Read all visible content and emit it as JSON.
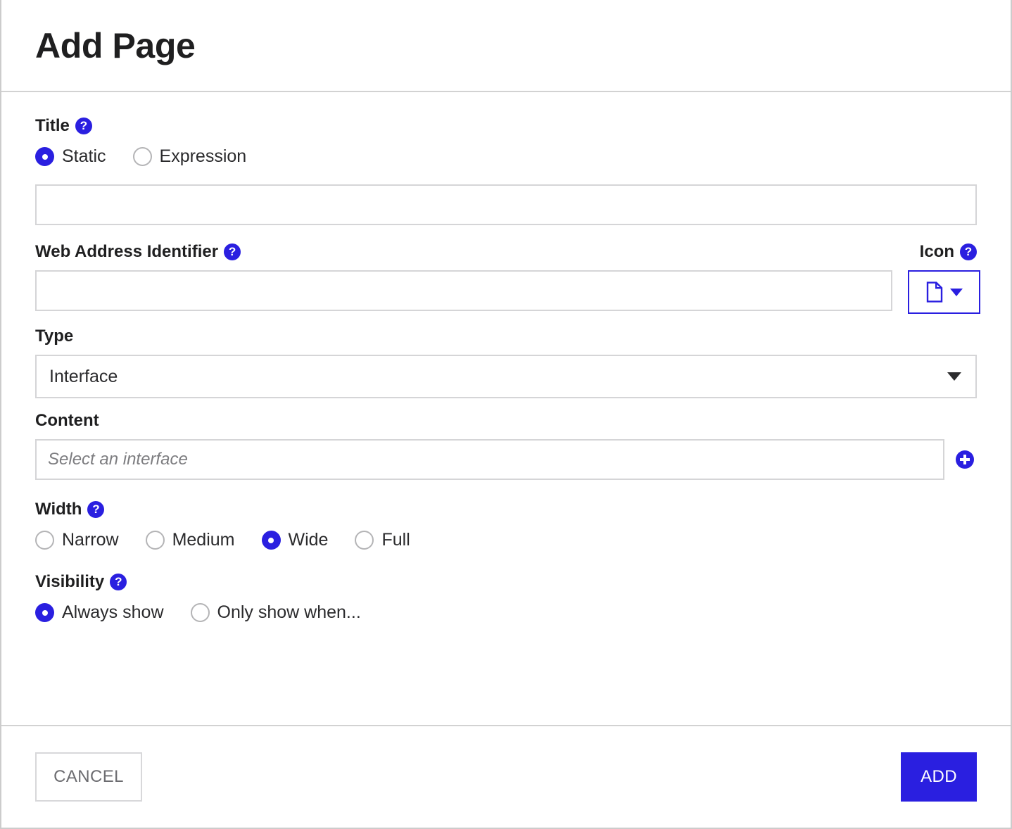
{
  "header": {
    "title": "Add Page"
  },
  "colors": {
    "accent": "#2a1fe0",
    "text": "#1f1f20",
    "border": "#d5d5d7",
    "placeholder": "#7d7d80",
    "cancel_text": "#6c6c70"
  },
  "fields": {
    "title": {
      "label": "Title",
      "help_icon": "help-circle-icon",
      "options": [
        {
          "label": "Static",
          "selected": true
        },
        {
          "label": "Expression",
          "selected": false
        }
      ],
      "value": "",
      "placeholder": ""
    },
    "web_address_identifier": {
      "label": "Web Address Identifier",
      "help_icon": "help-circle-icon",
      "value": "",
      "placeholder": ""
    },
    "icon": {
      "label": "Icon",
      "help_icon": "help-circle-icon",
      "selected_icon": "document-icon",
      "caret_icon": "chevron-down-icon"
    },
    "type": {
      "label": "Type",
      "value": "Interface",
      "options": [
        "Interface"
      ],
      "caret_icon": "chevron-down-icon"
    },
    "content": {
      "label": "Content",
      "value": "",
      "placeholder": "Select an interface",
      "add_icon": "plus-circle-icon"
    },
    "width": {
      "label": "Width",
      "help_icon": "help-circle-icon",
      "options": [
        {
          "label": "Narrow",
          "selected": false
        },
        {
          "label": "Medium",
          "selected": false
        },
        {
          "label": "Wide",
          "selected": true
        },
        {
          "label": "Full",
          "selected": false
        }
      ]
    },
    "visibility": {
      "label": "Visibility",
      "help_icon": "help-circle-icon",
      "options": [
        {
          "label": "Always show",
          "selected": true
        },
        {
          "label": "Only show when...",
          "selected": false
        }
      ]
    }
  },
  "footer": {
    "cancel_label": "CANCEL",
    "add_label": "ADD"
  },
  "help_glyph": "?"
}
